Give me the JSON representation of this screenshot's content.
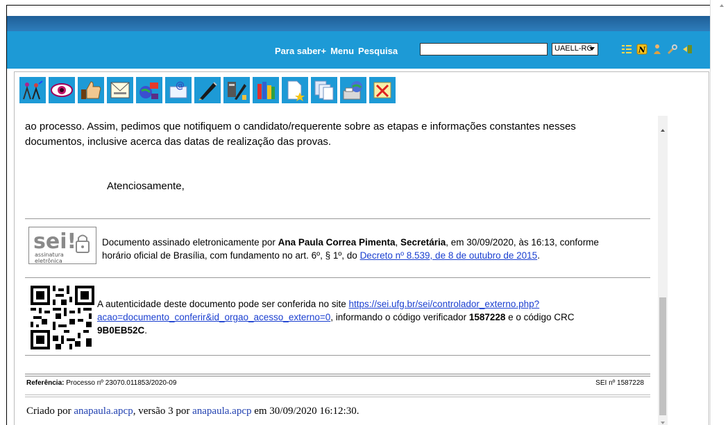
{
  "nav": {
    "links": [
      "Para saber+",
      "Menu",
      "Pesquisa"
    ],
    "search_value": "",
    "unit_selected": "UAELL-RC",
    "icons": [
      "list-icon",
      "notes-n-icon",
      "user-icon",
      "wrench-icon",
      "exit-icon"
    ]
  },
  "toolbar": {
    "buttons": [
      "process-people-icon",
      "eye-icon",
      "thumbs-up-icon",
      "envelope-print-icon",
      "globe-send-icon",
      "email-at-icon",
      "pen-sign-icon",
      "signature-block-icon",
      "books-icon",
      "new-document-star-icon",
      "copy-pages-icon",
      "scanner-globe-icon",
      "cancel-document-icon"
    ]
  },
  "document": {
    "para_line1": "ao processo. Assim, pedimos que notifiquem o candidato/requerente sobre as etapas e informações constantes nesses",
    "para_line2": "documentos, inclusive acerca das datas de realização das provas.",
    "closing": "Atenciosamente,",
    "sei_logo_main": "sei!",
    "sei_logo_sub1": "assinatura",
    "sei_logo_sub2": "eletrônica",
    "sign_prefix": "Documento assinado eletronicamente por ",
    "sign_name": "Ana Paula Correa Pimenta",
    "sign_sep": ", ",
    "sign_role": "Secretária",
    "sign_mid": ", em 30/09/2020, às 16:13, conforme",
    "sign_line2": "horário oficial de Brasília, com fundamento no art. 6º, § 1º, do ",
    "sign_link": "Decreto nº 8.539, de 8 de outubro de 2015",
    "sign_end": ".",
    "auth_prefix": "A autenticidade deste documento pode ser conferida no site ",
    "auth_link1": "https://sei.ufg.br/sei/controlador_externo.php?",
    "auth_link2": "acao=documento_conferir&id_orgao_acesso_externo=0",
    "auth_mid": ", informando o código verificador ",
    "auth_code": "1587228",
    "auth_mid2": " e o código CRC",
    "auth_crc": "9B0EB52C",
    "auth_end": ".",
    "ref_label": "Referência:",
    "ref_text": " Processo nº 23070.011853/2020-09",
    "sei_number": "SEI nº 1587228",
    "created_prefix": "Criado por ",
    "created_user1": "anapaula.apcp",
    "created_mid": ", versão 3 por ",
    "created_user2": "anapaula.apcp",
    "created_end": " em 30/09/2020 16:12:30."
  },
  "colors": {
    "navbar": "#1d9ad6",
    "topbar": "#2e7dbb",
    "link": "#1a3fd0"
  }
}
